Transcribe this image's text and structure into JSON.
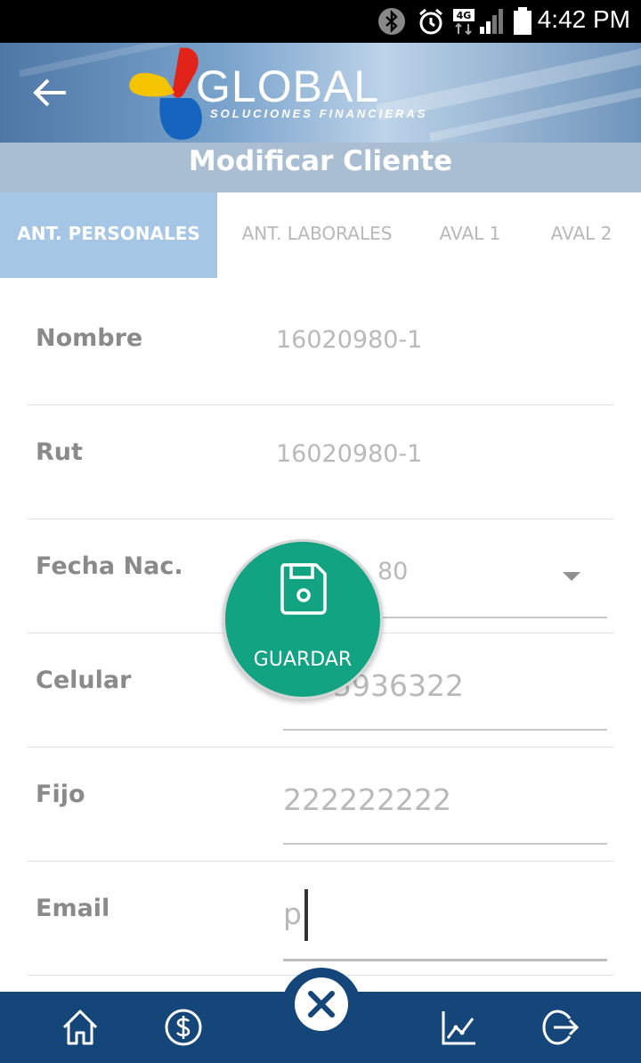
{
  "status_bar": {
    "time": "4:42 PM",
    "network": "4G",
    "icons": [
      "bluetooth-icon",
      "alarm-icon",
      "network-4g-icon",
      "signal-icon",
      "battery-icon"
    ]
  },
  "header": {
    "logo_text": "GLOBAL",
    "logo_subtitle": "SOLUCIONES FINANCIERAS",
    "back_icon": "arrow-left-icon"
  },
  "title": "Modificar Cliente",
  "tabs": [
    {
      "label": "ANT. PERSONALES",
      "active": true
    },
    {
      "label": "ANT. LABORALES",
      "active": false
    },
    {
      "label": "AVAL 1",
      "active": false
    },
    {
      "label": "AVAL 2",
      "active": false
    }
  ],
  "form": {
    "nombre": {
      "label": "Nombre",
      "value": "16020980-1"
    },
    "rut": {
      "label": "Rut",
      "value": "16020980-1"
    },
    "fecha_nac": {
      "label": "Fecha Nac.",
      "value": "80"
    },
    "celular": {
      "label": "Celular",
      "value": "5936322"
    },
    "fijo": {
      "label": "Fijo",
      "value": "222222222"
    },
    "email": {
      "label": "Email",
      "value": "p"
    }
  },
  "fab": {
    "label": "GUARDAR",
    "icon": "save-icon"
  },
  "bottom_nav": [
    "home-icon",
    "dollar-icon",
    "close-icon",
    "chart-icon",
    "logout-icon"
  ],
  "colors": {
    "active_tab": "#a5c6e5",
    "title_bar": "#a9bed3",
    "fab": "#12a383",
    "bottom_bar": "#14467a"
  }
}
